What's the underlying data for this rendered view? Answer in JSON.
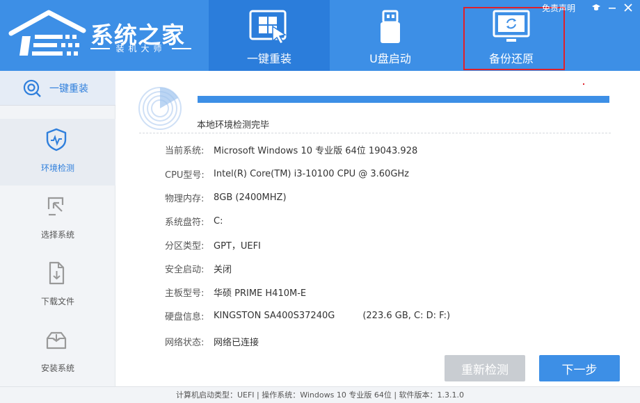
{
  "app": {
    "title": "系统之家",
    "subtitle": "装机大师"
  },
  "top_right": {
    "disclaimer": "免责声明"
  },
  "nav": {
    "tabs": [
      {
        "label": "一键重装",
        "active": true
      },
      {
        "label": "U盘启动",
        "active": false
      },
      {
        "label": "备份还原",
        "active": false
      }
    ]
  },
  "sidebar": {
    "top_label": "一键重装",
    "items": [
      {
        "label": "环境检测",
        "active": true
      },
      {
        "label": "选择系统",
        "active": false
      },
      {
        "label": "下载文件",
        "active": false
      },
      {
        "label": "安装系统",
        "active": false
      }
    ]
  },
  "main": {
    "progress": 1.0,
    "status": "本地环境检测完毕",
    "info": [
      {
        "label": "当前系统:",
        "value": "Microsoft Windows 10 专业版 64位 19043.928"
      },
      {
        "label": "CPU型号:",
        "value": "Intel(R) Core(TM) i3-10100 CPU @ 3.60GHz"
      },
      {
        "label": "物理内存:",
        "value": "8GB (2400MHZ)"
      },
      {
        "label": "系统盘符:",
        "value": "C:"
      },
      {
        "label": "分区类型:",
        "value": "GPT，UEFI"
      },
      {
        "label": "安全启动:",
        "value": "关闭"
      },
      {
        "label": "主板型号:",
        "value": "华硕 PRIME H410M-E"
      },
      {
        "label": "硬盘信息:",
        "value": "KINGSTON SA400S37240G",
        "value2": "(223.6 GB, C: D: F:)"
      },
      {
        "label": "网络状态:",
        "value": "网络已连接"
      }
    ],
    "buttons": {
      "rescan": "重新检测",
      "next": "下一步"
    }
  },
  "footer": {
    "text": "计算机启动类型：UEFI | 操作系统：Windows 10 专业版 64位 | 软件版本：1.3.1.0"
  },
  "colors": {
    "brand": "#3d8fe6",
    "active_tab": "#2b7ddb",
    "highlight": "#e0202a"
  }
}
